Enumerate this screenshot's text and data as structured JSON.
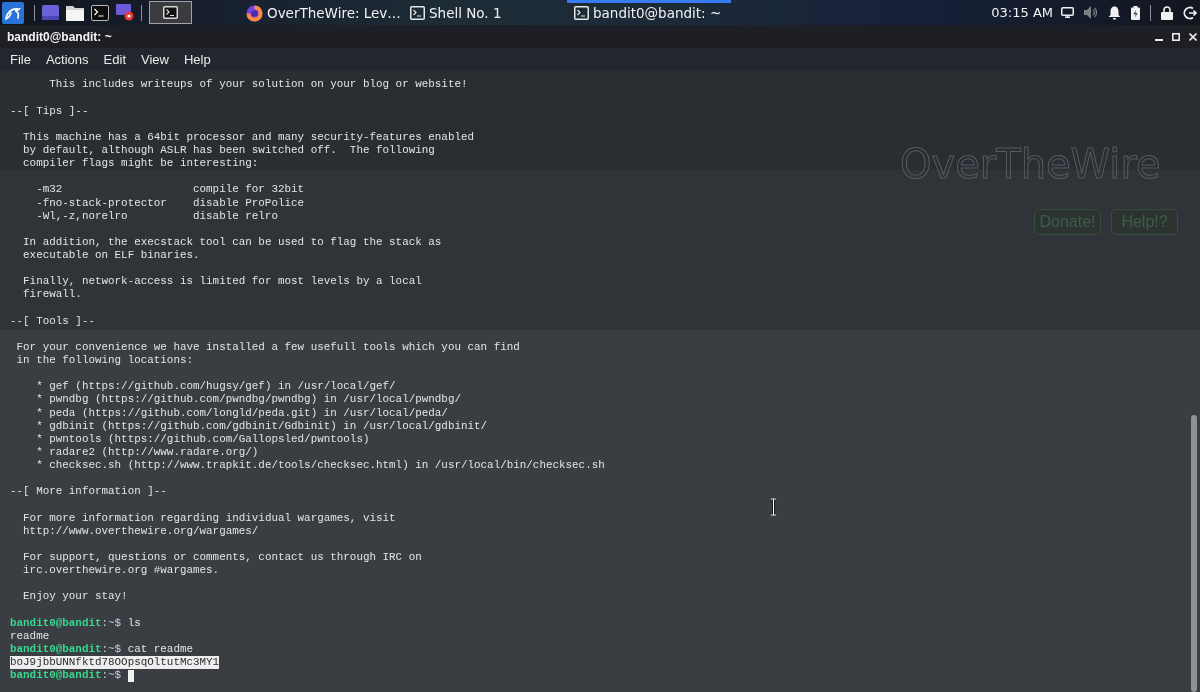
{
  "taskbar": {
    "tasks": [
      {
        "kind": "browser",
        "title": "OverTheWire: Lev…",
        "selected": false
      },
      {
        "kind": "terminal",
        "title": "Shell No. 1",
        "selected": false
      },
      {
        "kind": "terminal",
        "title": "bandit0@bandit: ~",
        "selected": true
      }
    ],
    "clock": "03:15 AM"
  },
  "background_page": {
    "logo": "OverTheWire",
    "buttons": [
      "Donate!",
      "Help!?"
    ]
  },
  "window": {
    "title": "bandit0@bandit: ~",
    "menu": [
      "File",
      "Actions",
      "Edit",
      "View",
      "Help"
    ]
  },
  "terminal": {
    "blocks": [
      {
        "kind": "text",
        "lines": [
          "      This includes writeups of your solution on your blog or website!"
        ]
      },
      {
        "kind": "heading",
        "lines": [
          "--[ Tips ]--"
        ]
      },
      {
        "kind": "text",
        "lines": [
          "  This machine has a 64bit processor and many security-features enabled",
          "  by default, although ASLR has been switched off.  The following",
          "  compiler flags might be interesting:"
        ]
      },
      {
        "kind": "table",
        "rows": [
          {
            "flag": "    -m32",
            "description": "compile for 32bit"
          },
          {
            "flag": "    -fno-stack-protector",
            "description": "disable ProPolice"
          },
          {
            "flag": "    -Wl,-z,norelro",
            "description": "disable relro"
          }
        ]
      },
      {
        "kind": "text",
        "lines": [
          "  In addition, the execstack tool can be used to flag the stack as",
          "  executable on ELF binaries."
        ]
      },
      {
        "kind": "text",
        "lines": [
          "  Finally, network-access is limited for most levels by a local",
          "  firewall."
        ]
      },
      {
        "kind": "heading",
        "lines": [
          "--[ Tools ]--"
        ]
      },
      {
        "kind": "text",
        "lines": [
          " For your convenience we have installed a few usefull tools which you can find",
          " in the following locations:"
        ]
      },
      {
        "kind": "list",
        "items": [
          "    * gef (https://github.com/hugsy/gef) in /usr/local/gef/",
          "    * pwndbg (https://github.com/pwndbg/pwndbg) in /usr/local/pwndbg/",
          "    * peda (https://github.com/longld/peda.git) in /usr/local/peda/",
          "    * gdbinit (https://github.com/gdbinit/Gdbinit) in /usr/local/gdbinit/",
          "    * pwntools (https://github.com/Gallopsled/pwntools)",
          "    * radare2 (http://www.radare.org/)",
          "    * checksec.sh (http://www.trapkit.de/tools/checksec.html) in /usr/local/bin/checksec.sh"
        ]
      },
      {
        "kind": "heading",
        "lines": [
          "--[ More information ]--"
        ]
      },
      {
        "kind": "text",
        "lines": [
          "  For more information regarding individual wargames, visit",
          "  http://www.overthewire.org/wargames/"
        ]
      },
      {
        "kind": "text",
        "lines": [
          "  For support, questions or comments, contact us through IRC on",
          "  irc.overthewire.org #wargames."
        ]
      },
      {
        "kind": "text",
        "lines": [
          "  Enjoy your stay!"
        ]
      },
      {
        "kind": "session",
        "lines": [
          {
            "kind": "prompt",
            "user": "bandit0@bandit",
            "path": ":~$",
            "command": "ls",
            "cursor": false
          },
          {
            "kind": "output",
            "text": "readme",
            "selected": false
          },
          {
            "kind": "prompt",
            "user": "bandit0@bandit",
            "path": ":~$",
            "command": "cat readme",
            "cursor": false
          },
          {
            "kind": "output",
            "text": "boJ9jbbUNNfktd78OOpsqOltutMc3MY1",
            "selected": true
          },
          {
            "kind": "prompt",
            "user": "bandit0@bandit",
            "path": ":~$",
            "cursor": true
          }
        ]
      }
    ]
  }
}
